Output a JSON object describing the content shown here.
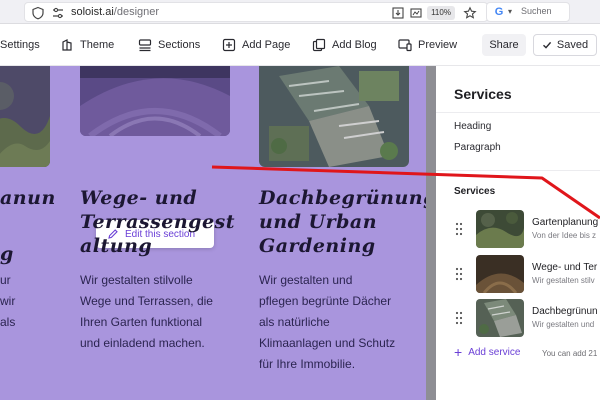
{
  "browser": {
    "url_domain": "soloist.ai",
    "url_path": "/designer",
    "zoom": "110%",
    "search_placeholder": "Suchen",
    "search_engine_logo": "G"
  },
  "toolbar": {
    "items": [
      {
        "label": "Settings",
        "icon": "settings-icon"
      },
      {
        "label": "Theme",
        "icon": "theme-icon"
      },
      {
        "label": "Sections",
        "icon": "sections-icon"
      },
      {
        "label": "Add Page",
        "icon": "add-page-icon"
      },
      {
        "label": "Add Blog",
        "icon": "add-blog-icon"
      },
      {
        "label": "Preview",
        "icon": "preview-icon"
      }
    ],
    "share_label": "Share",
    "saved_label": "Saved"
  },
  "canvas": {
    "edit_section_label": "Edit this section",
    "cards": [
      {
        "title_line1": "anun",
        "title_line2": "g",
        "text_lines": [
          "ur",
          "wir",
          "als"
        ]
      },
      {
        "title_line1": "Wege- und",
        "title_line2": "Terrassengest",
        "title_line3": "altung",
        "text_lines": [
          "Wir gestalten stilvolle",
          "Wege und Terrassen, die",
          "Ihren Garten funktional",
          "und einladend machen."
        ]
      },
      {
        "title_line1": "Dachbegrünung",
        "title_line2": "und Urban",
        "title_line3": "Gardening",
        "text_lines": [
          "Wir gestalten und",
          "pflegen begrünte Dächer",
          "als natürliche",
          "Klimaanlagen und Schutz",
          "für Ihre Immobilie."
        ]
      }
    ]
  },
  "panel": {
    "title": "Services",
    "fields": [
      "Heading",
      "Paragraph"
    ],
    "section_label": "Services",
    "services": [
      {
        "name": "Gartenplanung",
        "desc": "Von der Idee bis z"
      },
      {
        "name": "Wege- und Ter",
        "desc": "Wir gestalten stilv"
      },
      {
        "name": "Dachbegrünun",
        "desc": "Wir gestalten und"
      }
    ],
    "add_service_label": "Add service",
    "add_hint": "You can add 21"
  },
  "colors": {
    "accent": "#6a3fd6",
    "canvas_bg": "#a995dd",
    "annotation_arrow": "#e0161b"
  }
}
